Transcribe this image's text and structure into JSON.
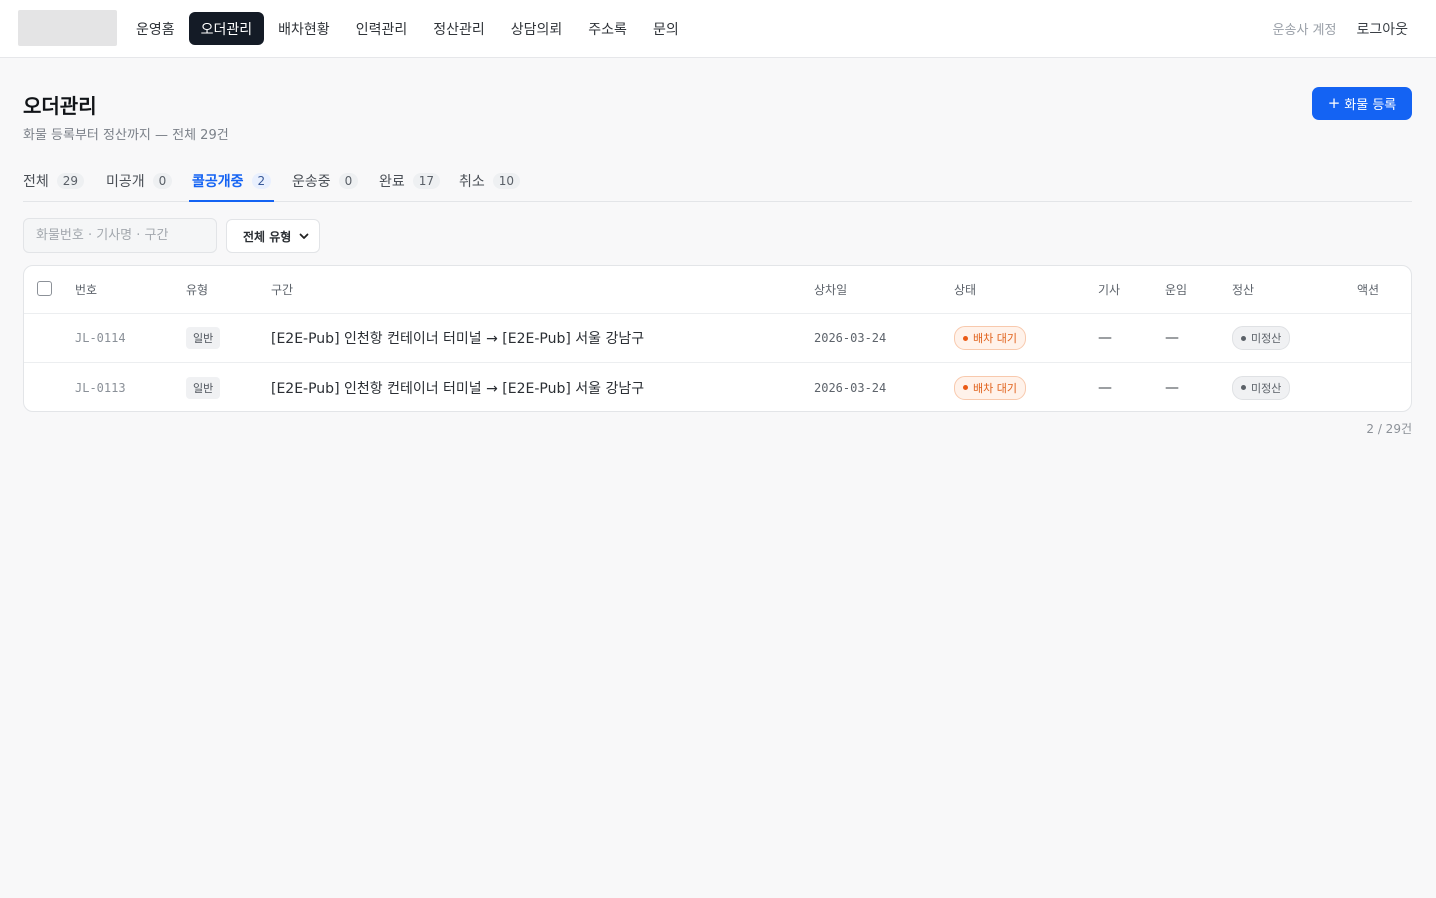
{
  "nav": {
    "items": [
      {
        "label": "운영홈",
        "active": false
      },
      {
        "label": "오더관리",
        "active": true
      },
      {
        "label": "배차현황",
        "active": false
      },
      {
        "label": "인력관리",
        "active": false
      },
      {
        "label": "정산관리",
        "active": false
      },
      {
        "label": "상담의뢰",
        "active": false
      },
      {
        "label": "주소록",
        "active": false
      },
      {
        "label": "문의",
        "active": false
      }
    ],
    "account_label": "운송사 계정",
    "logout_label": "로그아웃"
  },
  "page": {
    "title": "오더관리",
    "subtitle": "화물 등록부터 정산까지 — 전체 29건",
    "add_button_label": "화물 등록",
    "add_button_icon": "plus-icon"
  },
  "tabs": [
    {
      "label": "전체",
      "count": "29",
      "active": false
    },
    {
      "label": "미공개",
      "count": "0",
      "active": false
    },
    {
      "label": "콜공개중",
      "count": "2",
      "active": true
    },
    {
      "label": "운송중",
      "count": "0",
      "active": false
    },
    {
      "label": "완료",
      "count": "17",
      "active": false
    },
    {
      "label": "취소",
      "count": "10",
      "active": false
    }
  ],
  "filters": {
    "search_placeholder": "화물번호 · 기사명 · 구간",
    "search_value": "",
    "type_select_value": "전체 유형"
  },
  "table": {
    "columns": [
      "번호",
      "유형",
      "구간",
      "상차일",
      "상태",
      "기사",
      "운임",
      "정산",
      "액션"
    ],
    "rows": [
      {
        "id": "JL-0114",
        "type": "일반",
        "route": "[E2E-Pub] 인천항 컨테이너 터미널 → [E2E-Pub] 서울 강남구",
        "date": "2026-03-24",
        "status": "배차 대기",
        "driver": "—",
        "fare": "—",
        "settlement": "미정산"
      },
      {
        "id": "JL-0113",
        "type": "일반",
        "route": "[E2E-Pub] 인천항 컨테이너 터미널 → [E2E-Pub] 서울 강남구",
        "date": "2026-03-24",
        "status": "배차 대기",
        "driver": "—",
        "fare": "—",
        "settlement": "미정산"
      }
    ]
  },
  "pagination": {
    "text": "2 / 29건"
  },
  "colors": {
    "nav_active_bg": "#141b26",
    "primary": "#1463f3",
    "status_waiting": "#e1631d",
    "settlement_neutral": "#5b6168"
  }
}
